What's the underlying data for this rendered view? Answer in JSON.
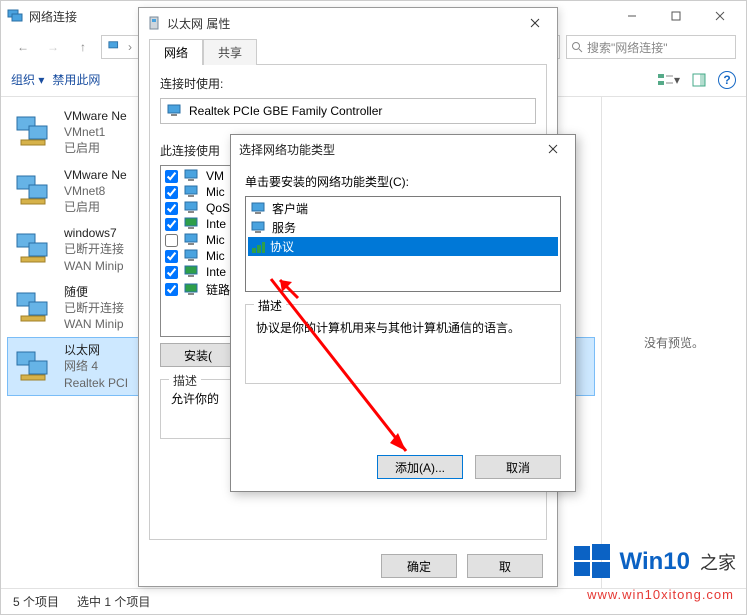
{
  "explorer": {
    "title": "网络连接",
    "search_placeholder": "搜索\"网络连接\"",
    "toolbar": {
      "organize": "组织 ▾",
      "disable": "禁用此网",
      "view_icon": "view-options",
      "preview_icon": "preview-pane",
      "help_icon": "help"
    },
    "connections": [
      {
        "name": "VMware Ne",
        "sub1": "VMnet1",
        "sub2": "已启用"
      },
      {
        "name": "VMware Ne",
        "sub1": "VMnet8",
        "sub2": "已启用"
      },
      {
        "name": "windows7",
        "sub1": "已断开连接",
        "sub2": "WAN Minip"
      },
      {
        "name": "随便",
        "sub1": "已断开连接",
        "sub2": "WAN Minip"
      },
      {
        "name": "以太网",
        "sub1": "网络 4",
        "sub2": "Realtek PCI",
        "selected": true
      }
    ],
    "preview_text": "没有预览。",
    "status": {
      "count": "5 个项目",
      "selected": "选中 1 个项目"
    }
  },
  "props": {
    "title": "以太网 属性",
    "tabs": {
      "net": "网络",
      "share": "共享"
    },
    "connect_using": "连接时使用:",
    "adapter": "Realtek PCIe GBE Family Controller",
    "items_label": "此连接使用",
    "items": [
      {
        "label": "VM",
        "checked": true
      },
      {
        "label": "Mic",
        "checked": true
      },
      {
        "label": "QoS",
        "checked": true
      },
      {
        "label": "Inte",
        "checked": true,
        "proto": true
      },
      {
        "label": "Mic",
        "checked": false
      },
      {
        "label": "Mic",
        "checked": true
      },
      {
        "label": "Inte",
        "checked": true,
        "proto": true
      },
      {
        "label": "链路",
        "checked": true,
        "proto": true
      }
    ],
    "buttons": {
      "install": "安装(",
      "uninstall": "",
      "props": ""
    },
    "desc_legend": "描述",
    "desc_text": "允许你的",
    "ok": "确定",
    "cancel": "取"
  },
  "dlg": {
    "title": "选择网络功能类型",
    "label": "单击要安装的网络功能类型(C):",
    "types": [
      {
        "label": "客户端"
      },
      {
        "label": "服务"
      },
      {
        "label": "协议",
        "selected": true
      }
    ],
    "desc_legend": "描述",
    "desc_text": "协议是你的计算机用来与其他计算机通信的语言。",
    "add": "添加(A)...",
    "cancel": "取消"
  },
  "watermark": {
    "brand": "Win10",
    "suffix": "之家",
    "url": "www.win10xitong.com"
  }
}
